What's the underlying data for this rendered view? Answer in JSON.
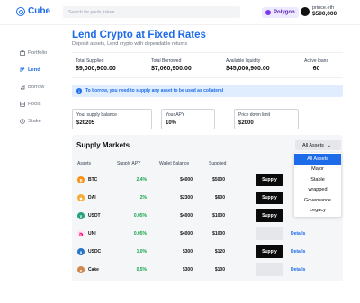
{
  "header": {
    "logo": "Cube",
    "search_placeholder": "Search for pools, token",
    "network": "Polygon",
    "account_name": "prince.eth",
    "account_balance": "$500,000"
  },
  "sidebar": {
    "items": [
      {
        "label": "Portfolio",
        "icon": "portfolio-icon"
      },
      {
        "label": "Lend",
        "icon": "lend-icon"
      },
      {
        "label": "Borrow",
        "icon": "borrow-icon"
      },
      {
        "label": "Pools",
        "icon": "pools-icon"
      },
      {
        "label": "Stake",
        "icon": "stake-icon"
      }
    ],
    "active": "Lend"
  },
  "main": {
    "title": "Lend Crypto at Fixed Rates",
    "subtitle": "Deposit assets, Lend crypto with dependable returns",
    "stats": [
      {
        "label": "Total Supplied",
        "value": "$9,000,900.00"
      },
      {
        "label": "Total Borrowed",
        "value": "$7,060,900.00"
      },
      {
        "label": "Available liquidity",
        "value": "$45,000,900.00"
      },
      {
        "label": "Active loans",
        "value": "60"
      }
    ],
    "alert": "To borrow, you need to supply any asset to be used as collateral",
    "fields": [
      {
        "label": "Your supply balance",
        "value": "$20205"
      },
      {
        "label": "Your APY",
        "value": "10%"
      },
      {
        "label": "Price down limit",
        "value": "$2000"
      }
    ]
  },
  "supply_markets": {
    "title": "Supply Markets",
    "filter_label": "All Assets",
    "columns": [
      "Assets",
      "Supply APY",
      "Wallet Balance",
      "Supplied"
    ],
    "rows": [
      {
        "asset": "BTC",
        "apy": "2.4%",
        "wallet": "$4000",
        "supplied": "$5000",
        "action": "Supply",
        "action_style": "dark",
        "details": ""
      },
      {
        "asset": "DAI",
        "apy": "2%",
        "wallet": "$2300",
        "supplied": "$600",
        "action": "Supply",
        "action_style": "dark",
        "details": ""
      },
      {
        "asset": "USDT",
        "apy": "0.05%",
        "wallet": "$4000",
        "supplied": "$1000",
        "action": "Supply",
        "action_style": "dark",
        "details": ""
      },
      {
        "asset": "UNI",
        "apy": "0.05%",
        "wallet": "$4000",
        "supplied": "$1000",
        "action": "Supply",
        "action_style": "light",
        "details": "Details"
      },
      {
        "asset": "USDC",
        "apy": "1.0%",
        "wallet": "$300",
        "supplied": "$120",
        "action": "Supply",
        "action_style": "dark",
        "details": "Details"
      },
      {
        "asset": "Cake",
        "apy": "0.5%",
        "wallet": "$300",
        "supplied": "$100",
        "action": "Supply",
        "action_style": "light",
        "details": "Details"
      }
    ],
    "dropdown_options": [
      "All Assets",
      "Major",
      "Stable",
      "wrapped",
      "Governance",
      "Legacy"
    ],
    "dropdown_selected": "All Assets"
  },
  "colors": {
    "accent": "#1d6be8",
    "positive": "#16a34a",
    "btc": "#f7931a",
    "dai": "#f5ac37",
    "usdt": "#26a17b",
    "uni": "#ff007a",
    "usdc": "#2775ca",
    "cake": "#d1884f"
  }
}
